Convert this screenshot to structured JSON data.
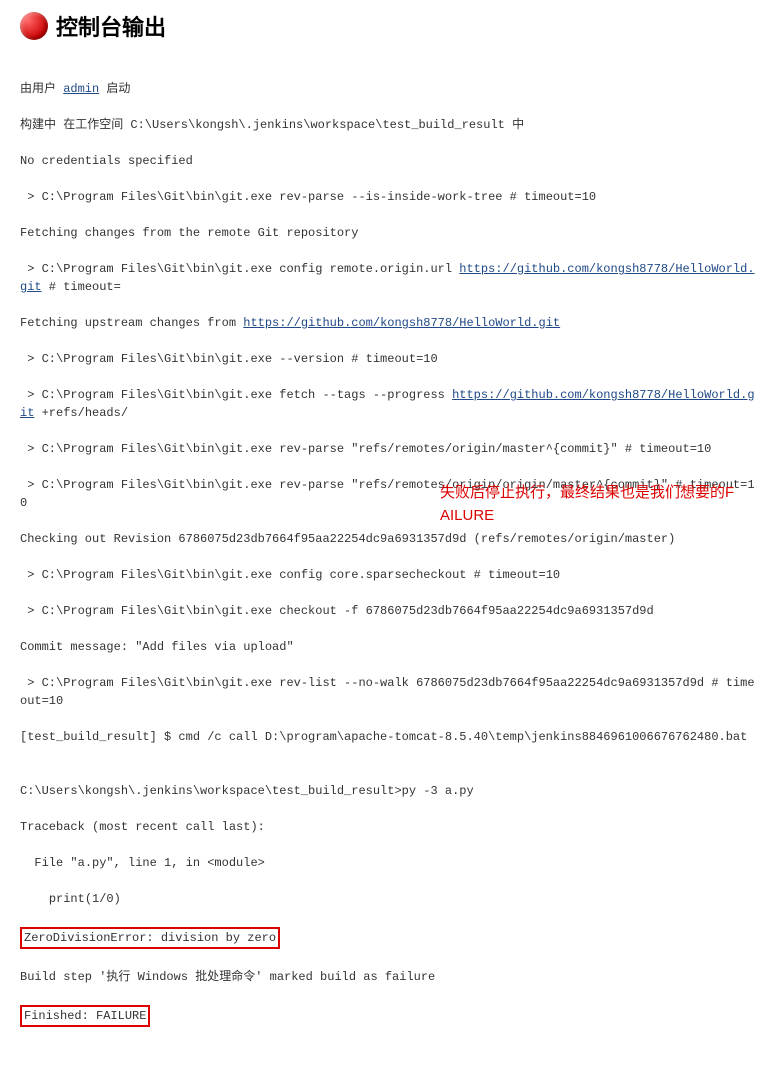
{
  "header": {
    "title": "控制台输出"
  },
  "console": {
    "l1_prefix": "由用户 ",
    "l1_link": "admin",
    "l1_suffix": " 启动",
    "l2": "构建中 在工作空间 C:\\Users\\kongsh\\.jenkins\\workspace\\test_build_result 中",
    "l3": "No credentials specified",
    "l4": " > C:\\Program Files\\Git\\bin\\git.exe rev-parse --is-inside-work-tree # timeout=10",
    "l5": "Fetching changes from the remote Git repository",
    "l6_prefix": " > C:\\Program Files\\Git\\bin\\git.exe config remote.origin.url ",
    "l6_link": "https://github.com/kongsh8778/HelloWorld.git",
    "l6_suffix": " # timeout=",
    "l7_prefix": "Fetching upstream changes from ",
    "l7_link": "https://github.com/kongsh8778/HelloWorld.git",
    "l8": " > C:\\Program Files\\Git\\bin\\git.exe --version # timeout=10",
    "l9_prefix": " > C:\\Program Files\\Git\\bin\\git.exe fetch --tags --progress ",
    "l9_link": "https://github.com/kongsh8778/HelloWorld.git",
    "l9_suffix": " +refs/heads/",
    "l10": " > C:\\Program Files\\Git\\bin\\git.exe rev-parse \"refs/remotes/origin/master^{commit}\" # timeout=10",
    "l11": " > C:\\Program Files\\Git\\bin\\git.exe rev-parse \"refs/remotes/origin/origin/master^{commit}\" # timeout=10",
    "l12": "Checking out Revision 6786075d23db7664f95aa22254dc9a6931357d9d (refs/remotes/origin/master)",
    "l13": " > C:\\Program Files\\Git\\bin\\git.exe config core.sparsecheckout # timeout=10",
    "l14": " > C:\\Program Files\\Git\\bin\\git.exe checkout -f 6786075d23db7664f95aa22254dc9a6931357d9d",
    "l15": "Commit message: \"Add files via upload\"",
    "l16": " > C:\\Program Files\\Git\\bin\\git.exe rev-list --no-walk 6786075d23db7664f95aa22254dc9a6931357d9d # timeout=10",
    "l17": "[test_build_result] $ cmd /c call D:\\program\\apache-tomcat-8.5.40\\temp\\jenkins8846961006676762480.bat",
    "l18": "",
    "l19": "C:\\Users\\kongsh\\.jenkins\\workspace\\test_build_result>py -3 a.py",
    "l20": "Traceback (most recent call last):",
    "l21": "  File \"a.py\", line 1, in <module>",
    "l22": "    print(1/0)",
    "l23": "ZeroDivisionError: division by zero",
    "l24": "Build step '执行 Windows 批处理命令' marked build as failure",
    "l25": "Finished: FAILURE"
  },
  "annotation": {
    "text": "失败后停止执行，最终结果也是我们想要的FAILURE"
  },
  "links": {
    "admin_href": "#",
    "repo_href": "https://github.com/kongsh8778/HelloWorld.git"
  }
}
